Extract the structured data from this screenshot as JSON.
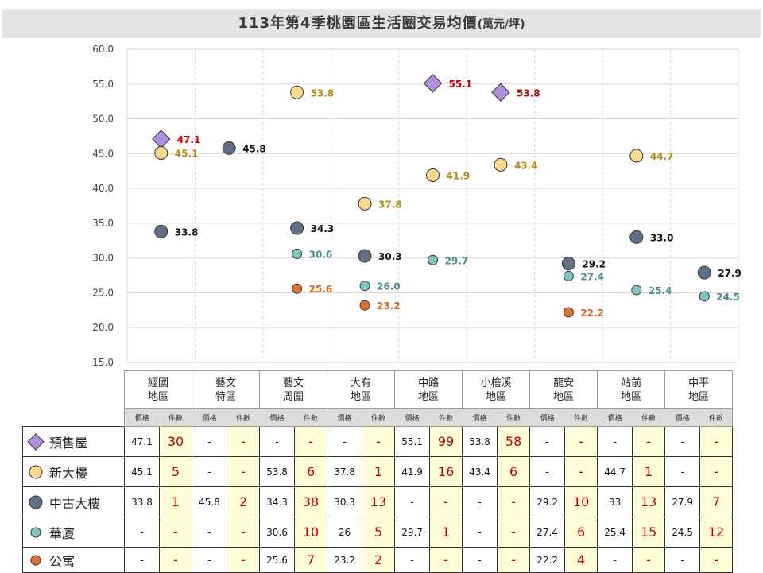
{
  "title": {
    "main": "113年第4季桃園區生活圈交易均價",
    "unit": "(萬元/坪)"
  },
  "colors": {
    "presale": "#b08ee0",
    "new": "#fbd98d",
    "used": "#5f7185",
    "huasha": "#7fc6c2",
    "apartment": "#e2712e"
  },
  "chart_data": {
    "type": "scatter",
    "title": "113年第4季桃園區生活圈交易均價(萬元/坪)",
    "categories": [
      "經國地區",
      "藝文特區",
      "藝文周圍",
      "大有地區",
      "中路地區",
      "小檜溪地區",
      "龍安地區",
      "站前地區",
      "中平地區"
    ],
    "ylim": [
      15.0,
      60.0
    ],
    "yticks": [
      "15.0",
      "20.0",
      "25.0",
      "30.0",
      "35.0",
      "40.0",
      "45.0",
      "50.0",
      "55.0",
      "60.0"
    ],
    "grid": true,
    "series": [
      {
        "name": "預售屋",
        "marker": "diamond",
        "color": "#b08ee0",
        "label_color": "#c00000",
        "values": [
          47.1,
          null,
          null,
          null,
          55.1,
          53.8,
          null,
          null,
          null
        ]
      },
      {
        "name": "新大樓",
        "marker": "circle",
        "color": "#fbd98d",
        "label_color": "#b08a12",
        "values": [
          45.1,
          null,
          53.8,
          37.8,
          41.9,
          43.4,
          null,
          44.7,
          null
        ]
      },
      {
        "name": "中古大樓",
        "marker": "circle",
        "color": "#5f7185",
        "label_color": "#111111",
        "values": [
          33.8,
          45.8,
          34.3,
          30.3,
          null,
          null,
          29.2,
          33.0,
          27.9
        ]
      },
      {
        "name": "華廈",
        "marker": "circle",
        "color": "#7fc6c2",
        "label_color": "#4a8c8e",
        "values": [
          null,
          null,
          30.6,
          26.0,
          29.7,
          null,
          27.4,
          25.4,
          24.5
        ]
      },
      {
        "name": "公寓",
        "marker": "circle",
        "color": "#e2712e",
        "label_color": "#d2691e",
        "values": [
          null,
          null,
          25.6,
          23.2,
          null,
          null,
          22.2,
          null,
          null
        ]
      }
    ],
    "point_labels": [
      [
        "47.1",
        "",
        "",
        "",
        "55.1",
        "53.8",
        "",
        "",
        ""
      ],
      [
        "45.1",
        "",
        "53.8",
        "37.8",
        "41.9",
        "43.4",
        "",
        "44.7",
        ""
      ],
      [
        "33.8",
        "45.8",
        "34.3",
        "30.3",
        "",
        "",
        "29.2",
        "33.0",
        "27.9"
      ],
      [
        "",
        "",
        "30.6",
        "26.0",
        "29.7",
        "",
        "27.4",
        "25.4",
        "24.5"
      ],
      [
        "",
        "",
        "25.6",
        "23.2",
        "",
        "",
        "22.2",
        "",
        ""
      ]
    ]
  },
  "table": {
    "regions": [
      [
        "經國",
        "地區"
      ],
      [
        "藝文",
        "特區"
      ],
      [
        "藝文",
        "周圍"
      ],
      [
        "大有",
        "地區"
      ],
      [
        "中路",
        "地區"
      ],
      [
        "小檜溪",
        "地區"
      ],
      [
        "龍安",
        "地區"
      ],
      [
        "站前",
        "地區"
      ],
      [
        "中平",
        "地區"
      ]
    ],
    "sub_headers": [
      "價格",
      "件數"
    ],
    "rows": [
      {
        "label": "預售屋",
        "cells": [
          [
            "47.1",
            "30"
          ],
          [
            "-",
            "-"
          ],
          [
            "-",
            "-"
          ],
          [
            "-",
            "-"
          ],
          [
            "55.1",
            "99"
          ],
          [
            "53.8",
            "58"
          ],
          [
            "-",
            "-"
          ],
          [
            "-",
            "-"
          ],
          [
            "-",
            "-"
          ]
        ]
      },
      {
        "label": "新大樓",
        "cells": [
          [
            "45.1",
            "5"
          ],
          [
            "-",
            "-"
          ],
          [
            "53.8",
            "6"
          ],
          [
            "37.8",
            "1"
          ],
          [
            "41.9",
            "16"
          ],
          [
            "43.4",
            "6"
          ],
          [
            "-",
            "-"
          ],
          [
            "44.7",
            "1"
          ],
          [
            "-",
            "-"
          ]
        ]
      },
      {
        "label": "中古大樓",
        "cells": [
          [
            "33.8",
            "1"
          ],
          [
            "45.8",
            "2"
          ],
          [
            "34.3",
            "38"
          ],
          [
            "30.3",
            "13"
          ],
          [
            "-",
            "-"
          ],
          [
            "-",
            "-"
          ],
          [
            "29.2",
            "10"
          ],
          [
            "33",
            "13"
          ],
          [
            "27.9",
            "7"
          ]
        ]
      },
      {
        "label": "華廈",
        "cells": [
          [
            "-",
            "-"
          ],
          [
            "-",
            "-"
          ],
          [
            "30.6",
            "10"
          ],
          [
            "26",
            "5"
          ],
          [
            "29.7",
            "1"
          ],
          [
            "-",
            "-"
          ],
          [
            "27.4",
            "6"
          ],
          [
            "25.4",
            "15"
          ],
          [
            "24.5",
            "12"
          ]
        ]
      },
      {
        "label": "公寓",
        "cells": [
          [
            "-",
            "-"
          ],
          [
            "-",
            "-"
          ],
          [
            "25.6",
            "7"
          ],
          [
            "23.2",
            "2"
          ],
          [
            "-",
            "-"
          ],
          [
            "-",
            "-"
          ],
          [
            "22.2",
            "4"
          ],
          [
            "-",
            "-"
          ],
          [
            "-",
            "-"
          ]
        ]
      }
    ]
  }
}
